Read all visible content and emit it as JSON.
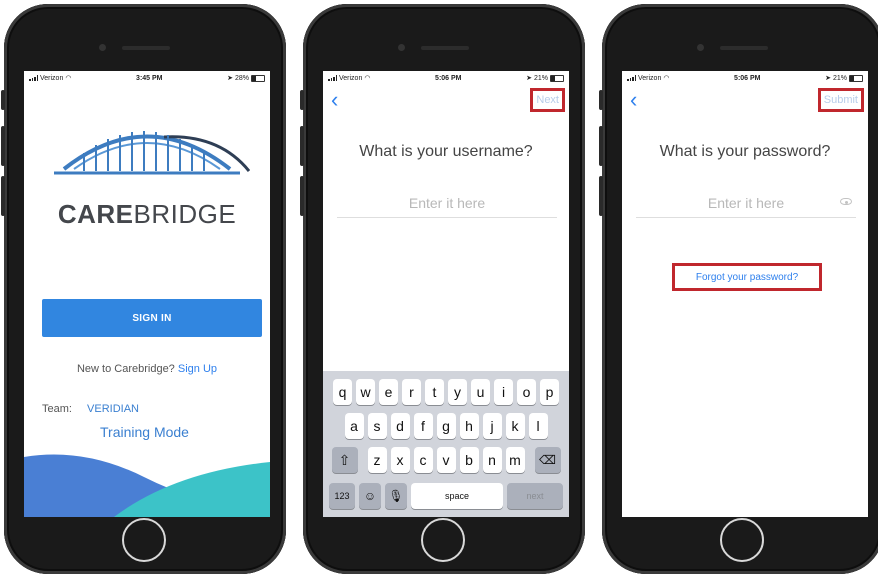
{
  "phone1": {
    "status": {
      "carrier": "Verizon",
      "time": "3:45 PM",
      "battery": "28%"
    },
    "brand": {
      "part1": "CARE",
      "part2": "BRIDGE"
    },
    "signin_label": "SIGN IN",
    "new_to_text": "New to Carebridge?",
    "signup_link": "Sign Up",
    "team_label": "Team:",
    "team_value": "VERIDIAN",
    "training_mode": "Training Mode"
  },
  "phone2": {
    "status": {
      "carrier": "Verizon",
      "time": "5:06 PM",
      "battery": "21%"
    },
    "back_icon": "chevron-left-icon",
    "next_label": "Next",
    "prompt": "What is your username?",
    "placeholder": "Enter it here",
    "keyboard": {
      "row1": [
        "q",
        "w",
        "e",
        "r",
        "t",
        "y",
        "u",
        "i",
        "o",
        "p"
      ],
      "row2": [
        "a",
        "s",
        "d",
        "f",
        "g",
        "h",
        "j",
        "k",
        "l"
      ],
      "row3": [
        "z",
        "x",
        "c",
        "v",
        "b",
        "n",
        "m"
      ],
      "numbers_label": "123",
      "space_label": "space",
      "return_label": "next"
    }
  },
  "phone3": {
    "status": {
      "carrier": "Verizon",
      "time": "5:06 PM",
      "battery": "21%"
    },
    "back_icon": "chevron-left-icon",
    "submit_label": "Submit",
    "prompt": "What is your password?",
    "placeholder": "Enter it here",
    "forgot_link": "Forgot your password?"
  },
  "colors": {
    "accent": "#3186e0",
    "highlight_box": "#c0272d",
    "keyboard_bg": "#d1d4db"
  }
}
